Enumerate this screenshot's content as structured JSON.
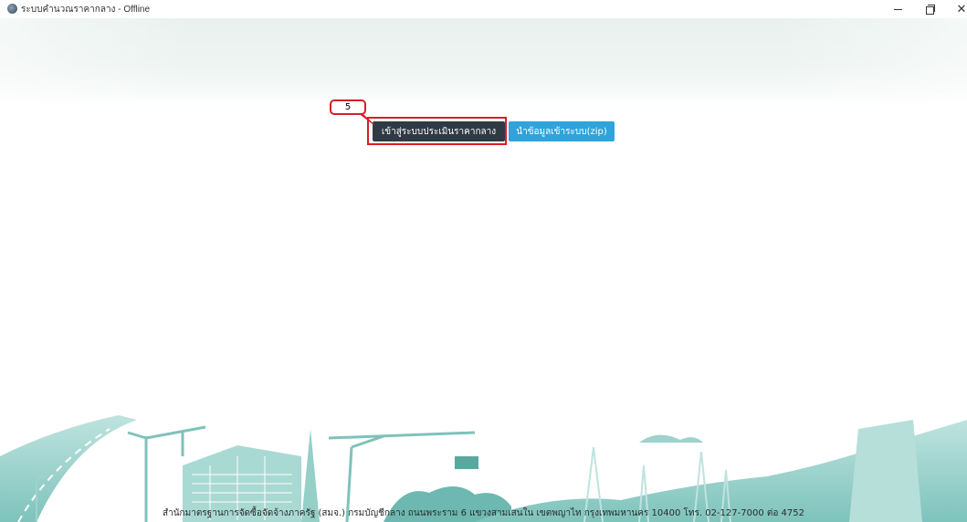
{
  "window": {
    "title": "ระบบคำนวณราคากลาง - Offline",
    "controls": {
      "minimize": "—",
      "maximize": "",
      "close": "✕"
    }
  },
  "main": {
    "buttons": {
      "login_label": "เข้าสู่ระบบประเมินราคากลาง",
      "import_label": "นำข้อมูลเข้าระบบ(zip)"
    },
    "annotation": {
      "step_number": "5"
    }
  },
  "footer": {
    "text": "สำนักมาตรฐานการจัดซื้อจัดจ้างภาครัฐ (สมจ.) กรมบัญชีกลาง ถนนพระราม 6 แขวงสามเสนใน เขตพญาไท กรุงเทพมหานคร 10400 โทร. 02-127-7000 ต่อ 4752"
  },
  "colors": {
    "login_button": "#2f3a45",
    "import_button": "#2fa3db",
    "annotation_red": "#d61f26",
    "illustration_teal": "#8fcfc9"
  },
  "icons": {
    "app": "app-icon",
    "minimize": "minimize-icon",
    "restore": "restore-icon",
    "close": "close-icon"
  }
}
